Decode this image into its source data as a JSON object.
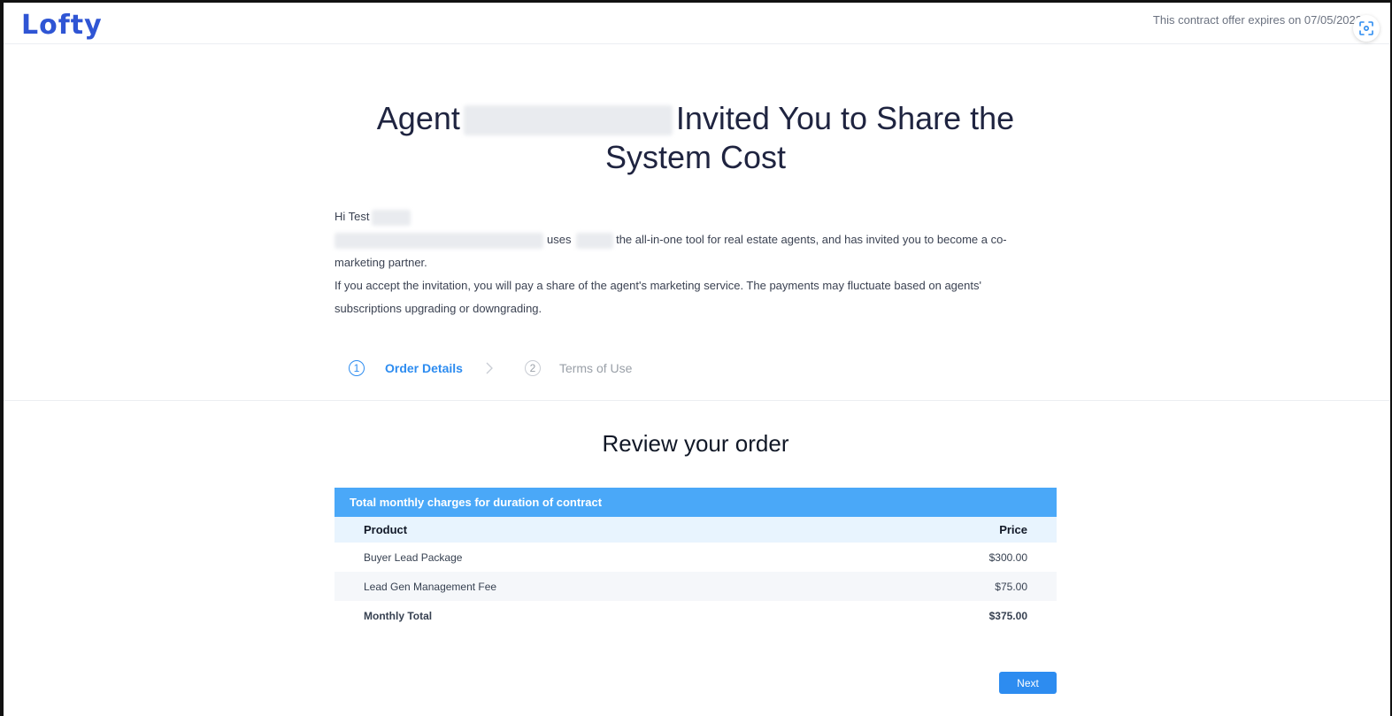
{
  "header": {
    "logo": "Lofty",
    "expires": "This contract offer expires on 07/05/2023",
    "scan_icon": "focus-scan-icon"
  },
  "hero": {
    "title_prefix": "Agent",
    "title_suffix": "Invited You to Share the System Cost"
  },
  "intro": {
    "greeting": "Hi Test",
    "line1_uses": "uses",
    "line1_rest": "the all-in-one tool for real estate agents, and has invited you to become a co-marketing partner.",
    "line2": "If you accept the invitation, you will pay a share of the agent's marketing service. The payments may fluctuate based on agents' subscriptions upgrading or downgrading."
  },
  "steps": [
    {
      "number": "1",
      "label": "Order Details",
      "active": true
    },
    {
      "number": "2",
      "label": "Terms of Use",
      "active": false
    }
  ],
  "review": {
    "title": "Review your order",
    "table_header": "Total monthly charges for duration of contract",
    "columns": {
      "product": "Product",
      "price": "Price"
    },
    "items": [
      {
        "product": "Buyer Lead Package",
        "price": "$300.00"
      },
      {
        "product": "Lead Gen Management Fee",
        "price": "$75.00"
      }
    ],
    "total": {
      "label": "Monthly Total",
      "price": "$375.00"
    }
  },
  "actions": {
    "next_label": "Next"
  },
  "colors": {
    "brand": "#2f55d4",
    "accent": "#2d8cf0",
    "table_header_bg": "#4aa8f8"
  }
}
